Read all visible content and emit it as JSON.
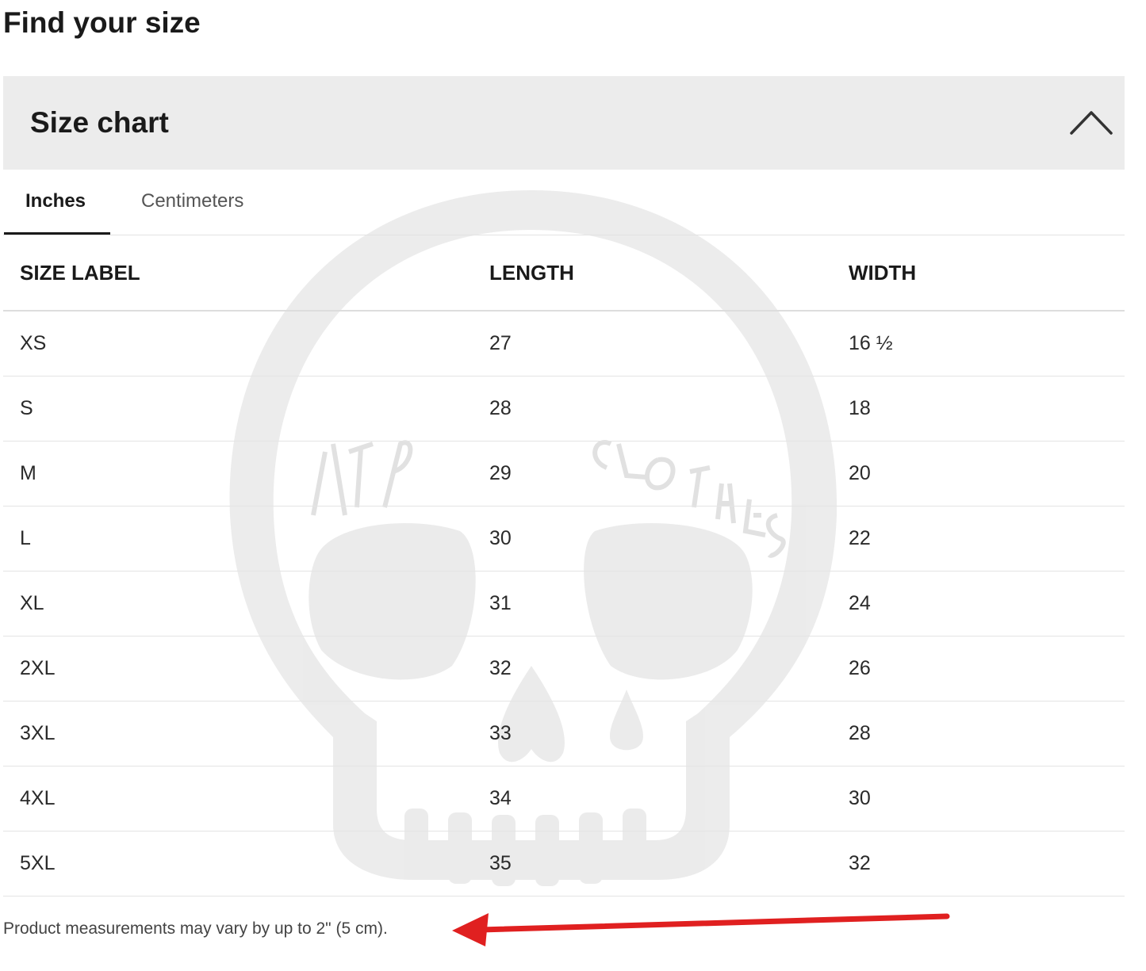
{
  "page": {
    "title": "Find your size"
  },
  "accordion": {
    "title": "Size chart",
    "expanded": true,
    "toggle_icon": "chevron-up-icon"
  },
  "tabs": [
    {
      "label": "Inches",
      "active": true
    },
    {
      "label": "Centimeters",
      "active": false
    }
  ],
  "table": {
    "headers": [
      "SIZE LABEL",
      "LENGTH",
      "WIDTH"
    ],
    "rows": [
      [
        "XS",
        "27",
        "16 ½"
      ],
      [
        "S",
        "28",
        "18"
      ],
      [
        "M",
        "29",
        "20"
      ],
      [
        "L",
        "30",
        "22"
      ],
      [
        "XL",
        "31",
        "24"
      ],
      [
        "2XL",
        "32",
        "26"
      ],
      [
        "3XL",
        "33",
        "28"
      ],
      [
        "4XL",
        "34",
        "30"
      ],
      [
        "5XL",
        "35",
        "32"
      ]
    ]
  },
  "note": "Product measurements may vary by up to 2\" (5 cm).",
  "annotation": {
    "icon": "arrow-left-icon",
    "color": "#e02020"
  },
  "watermark": {
    "icon": "skull-logo-icon",
    "text_left": "18TP",
    "text_right": "CLOTHES"
  },
  "colors": {
    "header_background": "#ececec",
    "text": "#1a1a1a",
    "divider": "#e4e4e4"
  }
}
